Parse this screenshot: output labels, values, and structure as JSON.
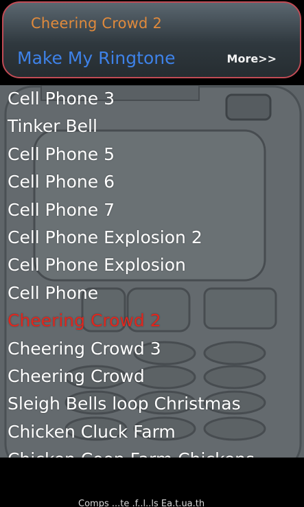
{
  "header": {
    "now_playing": "Cheering Crowd 2",
    "make_button": "Make My Ringtone",
    "more_button": "More>>"
  },
  "ringtones": [
    "Cell Phone 3",
    "Tinker Bell",
    "Cell Phone 5",
    "Cell Phone 6",
    "Cell Phone 7",
    "Cell Phone Explosion 2",
    "Cell Phone Explosion",
    "Cell Phone",
    "Cheering Crowd 2",
    "Cheering Crowd 3",
    "Cheering Crowd",
    "Sleigh Bells loop Christmas",
    "Chicken Cluck Farm",
    "Chicken Coop Farm Chickens"
  ],
  "selected_ringtone": "Cheering Crowd 2",
  "footer": {
    "text": "Comps ...te .f..l..ls Ea.t.ua.th"
  },
  "colors": {
    "header_border": "#c24b55",
    "now_playing": "#e08a3c",
    "make_button": "#3e82e8",
    "selected_item": "#e0261d",
    "list_text": "#ffffff"
  }
}
